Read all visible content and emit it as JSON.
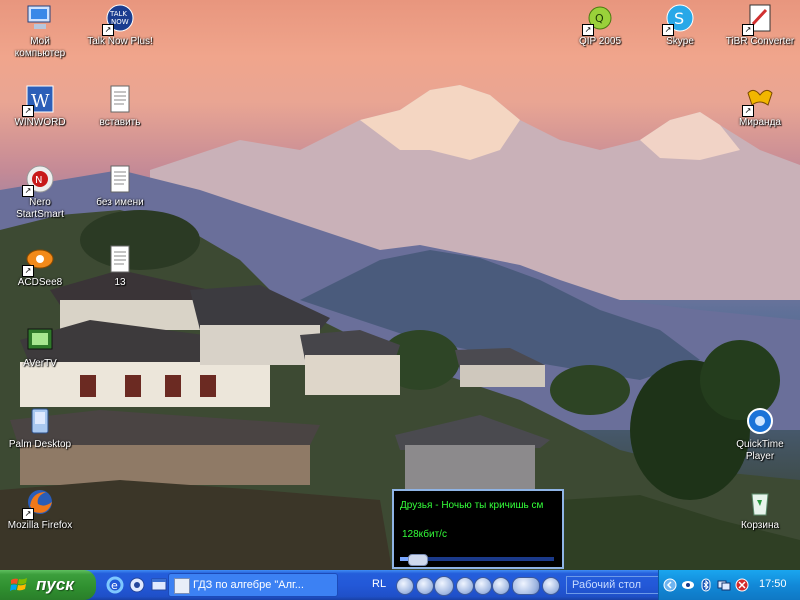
{
  "desktop": {
    "icons": [
      {
        "label": "Мой\nкомпьютер",
        "icon": "my-computer-icon",
        "shortcut": false
      },
      {
        "label": "Talk Now Plus!",
        "icon": "talk-now-icon",
        "shortcut": true
      },
      {
        "label": "QIP 2005",
        "icon": "qip-icon",
        "shortcut": true
      },
      {
        "label": "Skype",
        "icon": "skype-icon",
        "shortcut": true
      },
      {
        "label": "TiBR Converter",
        "icon": "tibr-converter-icon",
        "shortcut": true
      },
      {
        "label": "WINWORD",
        "icon": "word-icon",
        "shortcut": true
      },
      {
        "label": "вставить",
        "icon": "text-document-icon",
        "shortcut": false
      },
      {
        "label": "Миранда",
        "icon": "miranda-icon",
        "shortcut": true
      },
      {
        "label": "Nero\nStartSmart",
        "icon": "nero-icon",
        "shortcut": true
      },
      {
        "label": "без имени",
        "icon": "text-document-icon",
        "shortcut": false
      },
      {
        "label": "ACDSee8",
        "icon": "acdsee-icon",
        "shortcut": true
      },
      {
        "label": "13",
        "icon": "text-document-icon",
        "shortcut": false
      },
      {
        "label": "AVerTV",
        "icon": "avertv-icon",
        "shortcut": false
      },
      {
        "label": "Palm Desktop",
        "icon": "palm-desktop-icon",
        "shortcut": false
      },
      {
        "label": "QuickTime\nPlayer",
        "icon": "quicktime-icon",
        "shortcut": false
      },
      {
        "label": "Mozilla Firefox",
        "icon": "firefox-icon",
        "shortcut": true
      },
      {
        "label": "Корзина",
        "icon": "recycle-bin-icon",
        "shortcut": false
      }
    ]
  },
  "player": {
    "track": "Друзья - Ночью ты кричишь см",
    "bitrate": "128кбит/с",
    "progress": 0.08
  },
  "taskbar": {
    "start_label": "пуск",
    "quick_launch": [
      "internet-explorer-icon",
      "media-player-icon",
      "show-desktop-icon"
    ],
    "task": "ГДЗ по алгебре \"Алг...",
    "language": "RL",
    "deskbar": "Рабочий стол",
    "tray_icons": [
      "expand-arrow-icon",
      "eye-icon",
      "bluetooth-icon",
      "network-icon",
      "volume-icon",
      "shield-icon"
    ],
    "clock": "17:50"
  },
  "colors": {
    "taskbar": "#245edb",
    "start": "#3c9e3c",
    "tray": "#1289d8",
    "player_text": "#34ff3a"
  }
}
